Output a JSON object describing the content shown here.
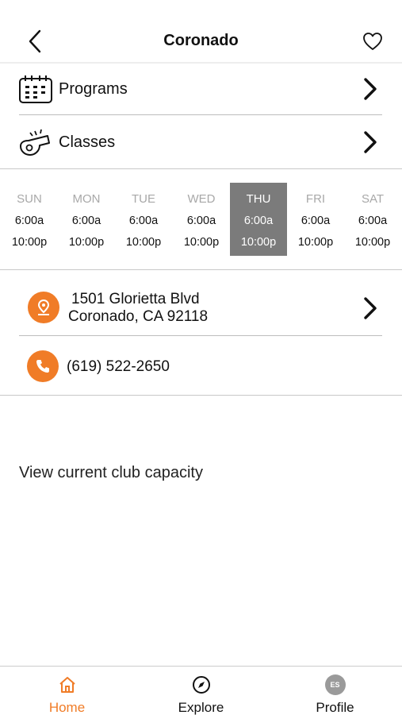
{
  "header": {
    "title": "Coronado",
    "back_icon": "chevron-left-icon",
    "favorite_icon": "heart-outline-icon"
  },
  "menu": [
    {
      "label": "Programs",
      "icon": "calendar-icon"
    },
    {
      "label": "Classes",
      "icon": "whistle-icon"
    }
  ],
  "hours": {
    "days": [
      {
        "name": "SUN",
        "open": "6:00a",
        "close": "10:00p"
      },
      {
        "name": "MON",
        "open": "6:00a",
        "close": "10:00p"
      },
      {
        "name": "TUE",
        "open": "6:00a",
        "close": "10:00p"
      },
      {
        "name": "WED",
        "open": "6:00a",
        "close": "10:00p"
      },
      {
        "name": "THU",
        "open": "6:00a",
        "close": "10:00p"
      },
      {
        "name": "FRI",
        "open": "6:00a",
        "close": "10:00p"
      },
      {
        "name": "SAT",
        "open": "6:00a",
        "close": "10:00p"
      }
    ],
    "active_day": "THU"
  },
  "location": {
    "line1": "1501 Glorietta Blvd",
    "line2": "Coronado, CA 92118",
    "icon": "map-pin-icon"
  },
  "contact": {
    "phone": "(619) 522-2650",
    "icon": "phone-icon"
  },
  "capacity_link": "View current club capacity",
  "tabbar": {
    "tabs": [
      {
        "label": "Home",
        "icon": "home-icon"
      },
      {
        "label": "Explore",
        "icon": "compass-icon"
      },
      {
        "label": "Profile",
        "icon": "avatar-icon",
        "initials": "ES"
      }
    ],
    "active_tab": "Home"
  },
  "colors": {
    "accent": "#f07c27",
    "active_day_bg": "#7b7b7b",
    "muted_text": "#a8a8a8"
  }
}
